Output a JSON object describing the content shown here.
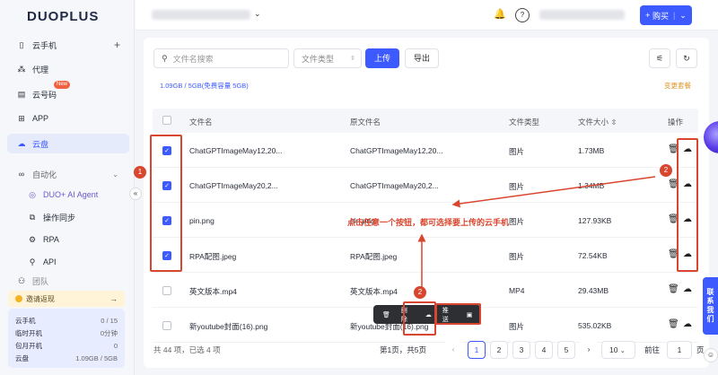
{
  "app": {
    "logo": "DUOPLUS"
  },
  "sidebar": {
    "items": [
      {
        "label": "云手机",
        "icon": "phone-icon"
      },
      {
        "label": "代理",
        "icon": "network-icon"
      },
      {
        "label": "云号码",
        "icon": "sim-icon",
        "badge": "New"
      },
      {
        "label": "APP",
        "icon": "apps-icon"
      },
      {
        "label": "云盘",
        "icon": "cloud-icon",
        "active": true
      },
      {
        "label": "自动化",
        "icon": "automation-icon"
      },
      {
        "label": "DUO+ AI Agent",
        "icon": "ai-agent-icon"
      },
      {
        "label": "操作同步",
        "icon": "sync-icon"
      },
      {
        "label": "RPA",
        "icon": "rpa-icon"
      },
      {
        "label": "API",
        "icon": "api-icon"
      },
      {
        "label": "团队",
        "icon": "team-icon"
      }
    ],
    "invite": "邀请返现",
    "stats": [
      {
        "label": "云手机",
        "value": "0 / 15"
      },
      {
        "label": "临时开机",
        "value": "0分钟"
      },
      {
        "label": "包月开机",
        "value": "0"
      },
      {
        "label": "云盘",
        "value": "1.09GB / 5GB"
      }
    ]
  },
  "topbar": {
    "buy_label": "购买",
    "buy_icon": "plus-icon"
  },
  "toolbar": {
    "search_placeholder": "文件名搜索",
    "file_type_placeholder": "文件类型",
    "upload_label": "上传",
    "export_label": "导出"
  },
  "quota": {
    "text": "1.09GB / 5GB(免费容量 5GB)",
    "change_plan": "变更套餐"
  },
  "table": {
    "headers": [
      "文件名",
      "原文件名",
      "文件类型",
      "文件大小",
      "操作"
    ],
    "rows": [
      {
        "name": "ChatGPTImageMay12,20...",
        "orig": "ChatGPTImageMay12,20...",
        "type": "图片",
        "size": "1.73MB",
        "checked": true
      },
      {
        "name": "ChatGPTImageMay20,2...",
        "orig": "ChatGPTImageMay20,2...",
        "type": "图片",
        "size": "1.34MB",
        "checked": true
      },
      {
        "name": "pin.png",
        "orig": "pin.png",
        "type": "图片",
        "size": "127.93KB",
        "checked": true
      },
      {
        "name": "RPA配图.jpeg",
        "orig": "RPA配图.jpeg",
        "type": "图片",
        "size": "72.54KB",
        "checked": true
      },
      {
        "name": "英文版本.mp4",
        "orig": "英文版本.mp4",
        "type": "MP4",
        "size": "29.43MB",
        "checked": false
      },
      {
        "name": "新youtube封面(16).png",
        "orig": "新youtube封面(16).png",
        "type": "图片",
        "size": "535.02KB",
        "checked": false
      }
    ]
  },
  "floatbar": {
    "delete": "删除",
    "push": "推送",
    "batch_push": "分批推送"
  },
  "footer": {
    "summary": "共 44 项，已选 4 项",
    "page_info": "第1页，共5页",
    "pages": [
      "1",
      "2",
      "3",
      "4",
      "5"
    ],
    "page_size": "10",
    "goto_label": "前往",
    "goto_value": "1",
    "page_suffix": "页"
  },
  "annotations": {
    "callout": "点击任意一个按钮，都可选择要上传的云手机",
    "num1": "1",
    "num2a": "2",
    "num2b": "2"
  },
  "right_panel": "联系我们"
}
